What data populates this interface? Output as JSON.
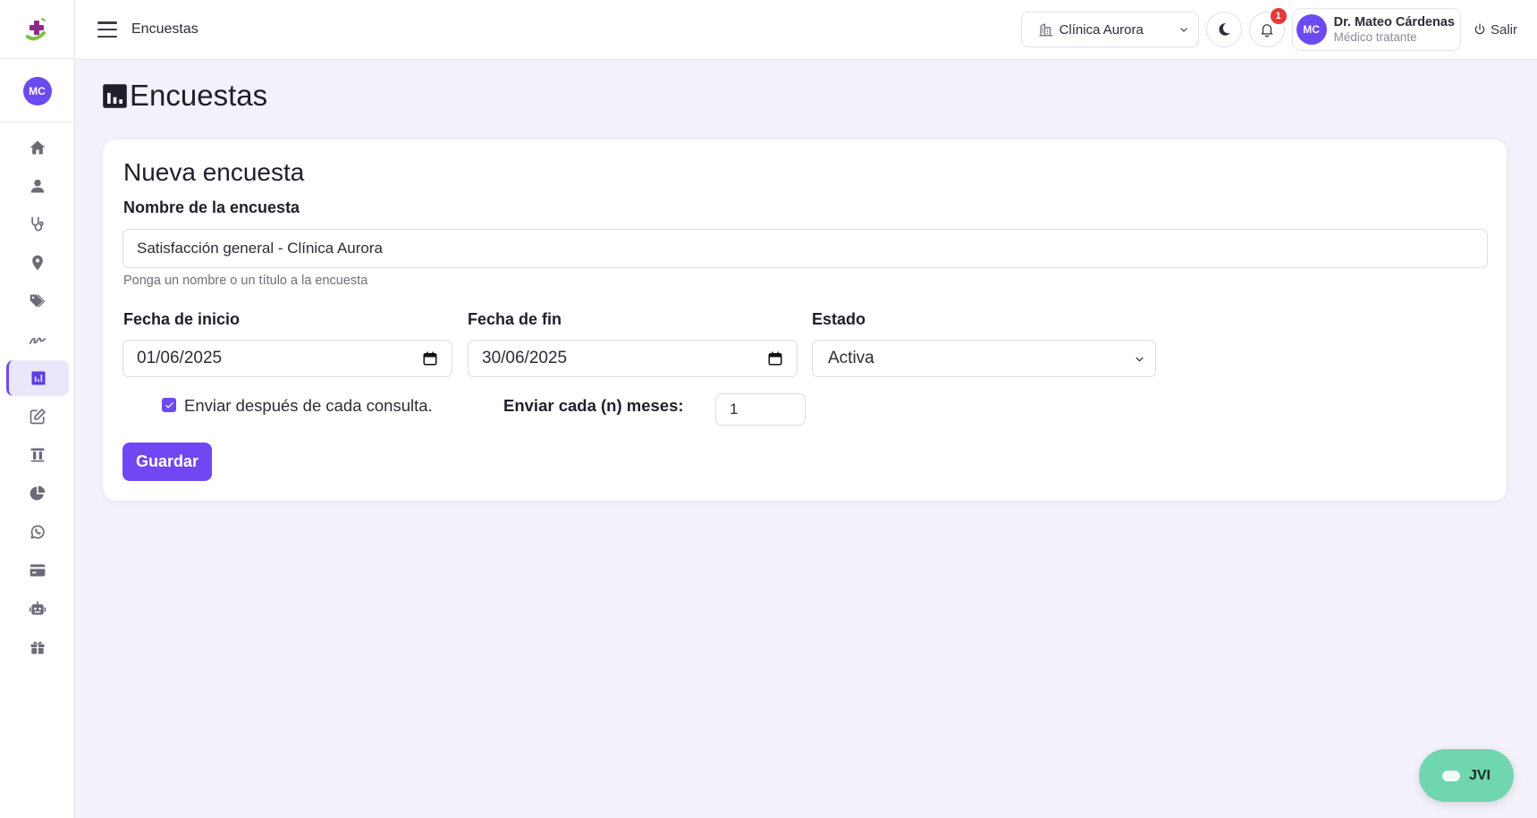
{
  "topbar": {
    "title": "Encuestas",
    "clinic": "Clínica Aurora",
    "notification_count": "1",
    "user_initials": "MC",
    "user_name": "Dr. Mateo Cárdenas",
    "user_role": "Médico tratante",
    "logout_label": "Salir"
  },
  "sidebar": {
    "avatar_initials": "MC",
    "items": [
      {
        "icon": "home-icon"
      },
      {
        "icon": "user-icon"
      },
      {
        "icon": "stethoscope-icon"
      },
      {
        "icon": "map-pin-icon"
      },
      {
        "icon": "tags-icon"
      },
      {
        "icon": "signature-icon"
      },
      {
        "icon": "chart-bar-icon",
        "active": true
      },
      {
        "icon": "edit-icon"
      },
      {
        "icon": "lab-tubes-icon"
      },
      {
        "icon": "pie-chart-icon"
      },
      {
        "icon": "whatsapp-icon"
      },
      {
        "icon": "credit-card-icon"
      },
      {
        "icon": "robot-icon"
      },
      {
        "icon": "gift-icon"
      }
    ]
  },
  "page": {
    "heading": "Encuestas"
  },
  "form": {
    "title": "Nueva encuesta",
    "name_label": "Nombre de la encuesta",
    "name_value": "Satisfacción general - Clínica Aurora",
    "name_hint": "Ponga un nombre o un título a la encuesta",
    "start_label": "Fecha de inicio",
    "start_value": "01/06/2025",
    "end_label": "Fecha de fin",
    "end_value": "30/06/2025",
    "status_label": "Estado",
    "status_value": "Activa",
    "send_after_label": "Enviar después de cada consulta.",
    "send_after_checked": true,
    "months_label": "Enviar cada (n) meses:",
    "months_value": "1",
    "save_label": "Guardar"
  },
  "chat": {
    "label": "JVI"
  },
  "colors": {
    "accent": "#7047f0",
    "background": "#f3f1fa",
    "chat": "#6fd6b0",
    "badge": "#e53a3a"
  }
}
